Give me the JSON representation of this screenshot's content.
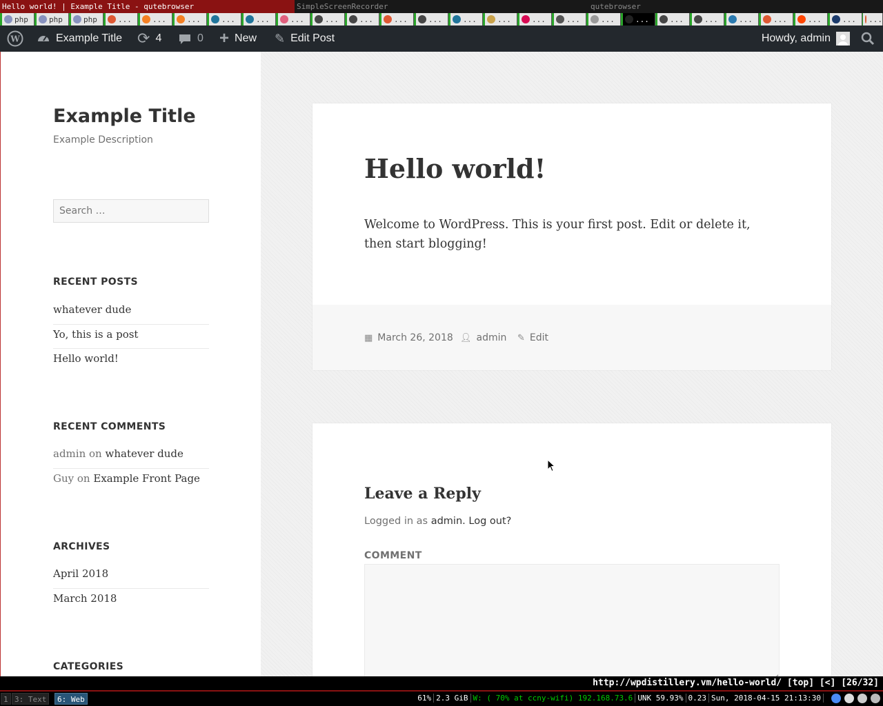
{
  "wm_titles": [
    {
      "title": "Hello world! | Example Title - qutebrowser",
      "active": true
    },
    {
      "title": "SimpleScreenRecorder",
      "active": false
    },
    {
      "title": "qutebrowser",
      "active": false
    }
  ],
  "browser_tabs": [
    {
      "icon": "php-icon",
      "color": "#8892bf",
      "label": "php"
    },
    {
      "icon": "php-icon",
      "color": "#8892bf",
      "label": "php"
    },
    {
      "icon": "php-icon",
      "color": "#8892bf",
      "label": "php"
    },
    {
      "icon": "duckduckgo-icon",
      "color": "#de5833",
      "label": "..."
    },
    {
      "icon": "stackoverflow-icon",
      "color": "#f48024",
      "label": "..."
    },
    {
      "icon": "stackoverflow-icon",
      "color": "#f48024",
      "label": "..."
    },
    {
      "icon": "wordpress-icon",
      "color": "#21759b",
      "label": "..."
    },
    {
      "icon": "wordpress-icon",
      "color": "#21759b",
      "label": "..."
    },
    {
      "icon": "pink-icon",
      "color": "#e0607e",
      "label": "..."
    },
    {
      "icon": "wordpress-icon",
      "color": "#464646",
      "label": "..."
    },
    {
      "icon": "wordpress-icon",
      "color": "#464646",
      "label": "..."
    },
    {
      "icon": "duckduckgo-icon",
      "color": "#de5833",
      "label": "..."
    },
    {
      "icon": "wordpress-icon",
      "color": "#464646",
      "label": "..."
    },
    {
      "icon": "wordpress-icon",
      "color": "#21759b",
      "label": "..."
    },
    {
      "icon": "image-icon",
      "color": "#c9a24a",
      "label": "..."
    },
    {
      "icon": "debian-icon",
      "color": "#d70a53",
      "label": "..."
    },
    {
      "icon": "search-icon",
      "color": "#555555",
      "label": "..."
    },
    {
      "icon": "blank-icon",
      "color": "#999999",
      "label": "..."
    },
    {
      "icon": "terminal-icon",
      "color": "#222222",
      "label": "..."
    },
    {
      "icon": "wordpress-icon",
      "color": "#464646",
      "label": "..."
    },
    {
      "icon": "wordpress-icon",
      "color": "#464646",
      "label": "..."
    },
    {
      "icon": "spiral-icon",
      "color": "#2a7ab0",
      "label": "..."
    },
    {
      "icon": "duckduckgo-icon",
      "color": "#de5833",
      "label": "..."
    },
    {
      "icon": "reddit-icon",
      "color": "#ff4500",
      "label": "..."
    },
    {
      "icon": "m-icon",
      "color": "#1b3a6b",
      "label": "..."
    },
    {
      "icon": "duckduckgo-icon",
      "color": "#de5833",
      "label": "..."
    }
  ],
  "admin_bar": {
    "site_name": "Example Title",
    "updates_count": "4",
    "comments_count": "0",
    "new_label": "New",
    "edit_post_label": "Edit Post",
    "howdy": "Howdy, admin"
  },
  "sidebar": {
    "site_title": "Example Title",
    "site_description": "Example Description",
    "search_placeholder": "Search …",
    "recent_posts_title": "RECENT POSTS",
    "recent_posts": [
      "whatever dude",
      "Yo, this is a post",
      "Hello world!"
    ],
    "recent_comments_title": "RECENT COMMENTS",
    "recent_comments": [
      {
        "author": "admin",
        "on": "on",
        "post": "whatever dude"
      },
      {
        "author": "Guy",
        "on": "on",
        "post": "Example Front Page"
      }
    ],
    "archives_title": "ARCHIVES",
    "archives": [
      "April 2018",
      "March 2018"
    ],
    "categories_title": "CATEGORIES"
  },
  "post": {
    "title": "Hello world!",
    "content": "Welcome to WordPress. This is your first post. Edit or delete it, then start blogging!",
    "date": "March 26, 2018",
    "author": "admin",
    "edit": "Edit"
  },
  "reply": {
    "title": "Leave a Reply",
    "logged_in_prefix": "Logged in as",
    "logged_in_user": "admin.",
    "logout": "Log out?",
    "comment_label": "COMMENT"
  },
  "statusbar": {
    "url": "http://wpdistillery.vm/hello-world/ [top] [<] [26/32]"
  },
  "i3bar": {
    "workspaces": [
      {
        "label": "1",
        "focused": false
      },
      {
        "label": "3: Text",
        "focused": false
      },
      {
        "label": "6: Web",
        "focused": true
      }
    ],
    "blocks": [
      {
        "text": "61%",
        "color": "#ffffff"
      },
      {
        "text": "2.3 GiB",
        "color": "#ffffff"
      },
      {
        "text": "W: ( 70% at ccny-wifi) 192.168.73.6",
        "color": "#00cc00"
      },
      {
        "text": "UNK 59.93%",
        "color": "#ffffff"
      },
      {
        "text": "0.23",
        "color": "#ffffff"
      },
      {
        "text": "Sun, 2018-04-15 21:13:30",
        "color": "#ffffff"
      }
    ],
    "tray": [
      {
        "icon": "chromium-icon",
        "color": "#4a8af4"
      },
      {
        "icon": "settings-icon",
        "color": "#dddddd"
      },
      {
        "icon": "network-icon",
        "color": "#cccccc"
      },
      {
        "icon": "lock-icon",
        "color": "#bbbbbb"
      }
    ]
  }
}
